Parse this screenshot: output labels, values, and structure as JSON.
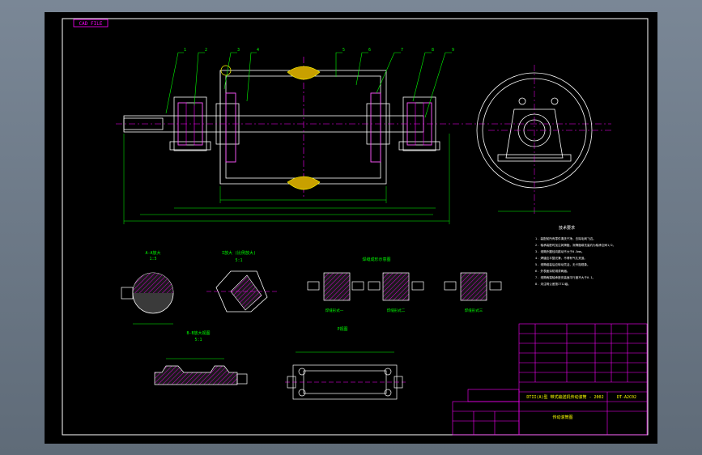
{
  "drawing": {
    "tag_label": "CAD FILE",
    "callouts": [
      "1",
      "2",
      "3",
      "4",
      "5",
      "6",
      "7",
      "8",
      "9"
    ],
    "circle_marks": [
      "A",
      "B"
    ],
    "detail_titles": {
      "section_a": "A-A放大",
      "section_a_scale": "1:5",
      "detail_i": "I放大 (比例放大)",
      "detail_i_scale": "5:1",
      "detail_b": "B-B放大视图",
      "detail_b_scale": "5:1",
      "bottom_mid": "P视图",
      "weld_group": "焊缝成形示意图"
    },
    "weld_captions": [
      "焊缝形式一",
      "焊缝形式二",
      "焊缝形式三"
    ],
    "tech_notes_title": "技术要求",
    "tech_notes": [
      "1. 装配前所有零件清洗干净，去除毛刺飞边。",
      "2. 轴承装配时加注润滑脂，润滑脂填充量约为轴承空间1/2。",
      "3. 滚筒外圆径向跳动不大于0.5mm。",
      "4. 焊缝应平整光滑，不得有气孔夹渣。",
      "5. 滚筒组装后应转动灵活，无卡阻现象。",
      "6. 外表面涂防锈漆两遍。",
      "7. 滚筒两端轴承座安装面平行度不大于0.1。",
      "8. 未注明公差按IT12级。"
    ],
    "title_block": {
      "drawing_title": "DTII(A)型  带式输送机传动滚筒 - 2002",
      "drawing_no": "DT-A2C02",
      "part_name": "传动滚筒图"
    }
  },
  "colors": {
    "background": "#000000",
    "frame": "#ffffff",
    "outline": "#ffffff",
    "dimension": "#00ff00",
    "hatch": "#ff00ff",
    "centerline": "#ff00ff",
    "callout": "#00ff00",
    "title_block": "#ff00ff",
    "yellow": "#ffff00"
  }
}
